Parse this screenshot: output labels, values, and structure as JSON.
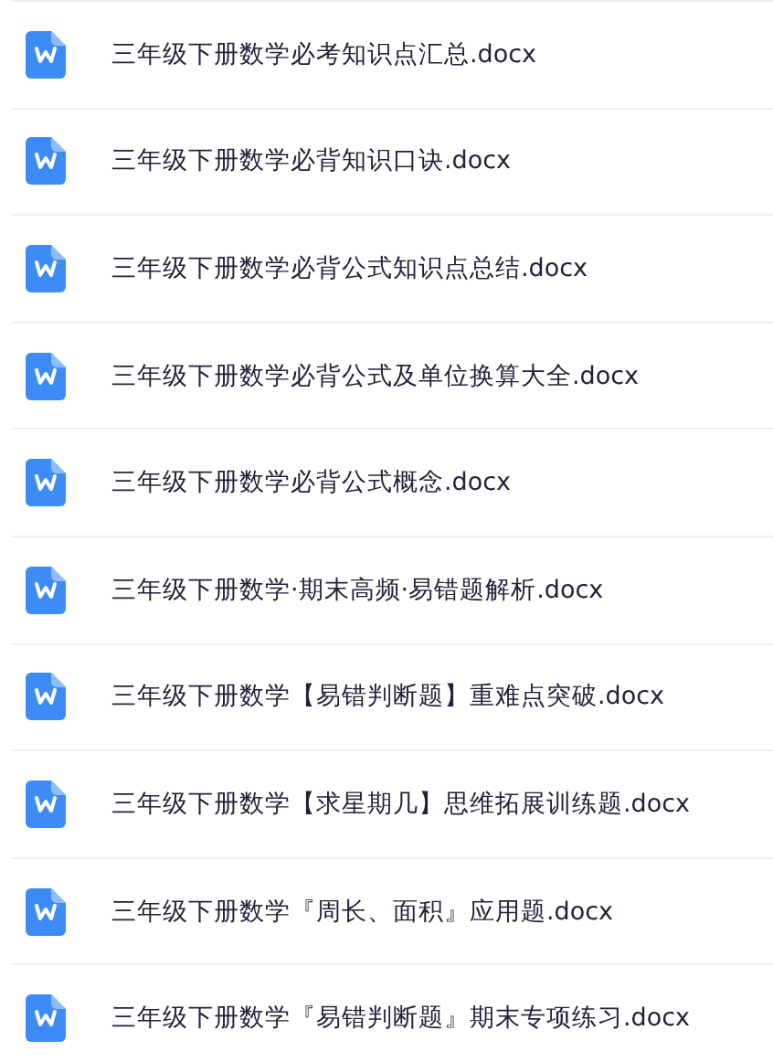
{
  "files": [
    {
      "name": "三年级下册数学必考知识点汇总.docx",
      "kind": "word"
    },
    {
      "name": "三年级下册数学必背知识口诀.docx",
      "kind": "word"
    },
    {
      "name": "三年级下册数学必背公式知识点总结.docx",
      "kind": "word"
    },
    {
      "name": "三年级下册数学必背公式及单位换算大全.docx",
      "kind": "word"
    },
    {
      "name": "三年级下册数学必背公式概念.docx",
      "kind": "word"
    },
    {
      "name": "三年级下册数学·期末高频·易错题解析.docx",
      "kind": "word"
    },
    {
      "name": "三年级下册数学【易错判断题】重难点突破.docx",
      "kind": "word"
    },
    {
      "name": "三年级下册数学【求星期几】思维拓展训练题.docx",
      "kind": "word"
    },
    {
      "name": "三年级下册数学『周长、面积』应用题.docx",
      "kind": "word"
    },
    {
      "name": "三年级下册数学『易错判断题』期末专项练习.docx",
      "kind": "word"
    }
  ]
}
